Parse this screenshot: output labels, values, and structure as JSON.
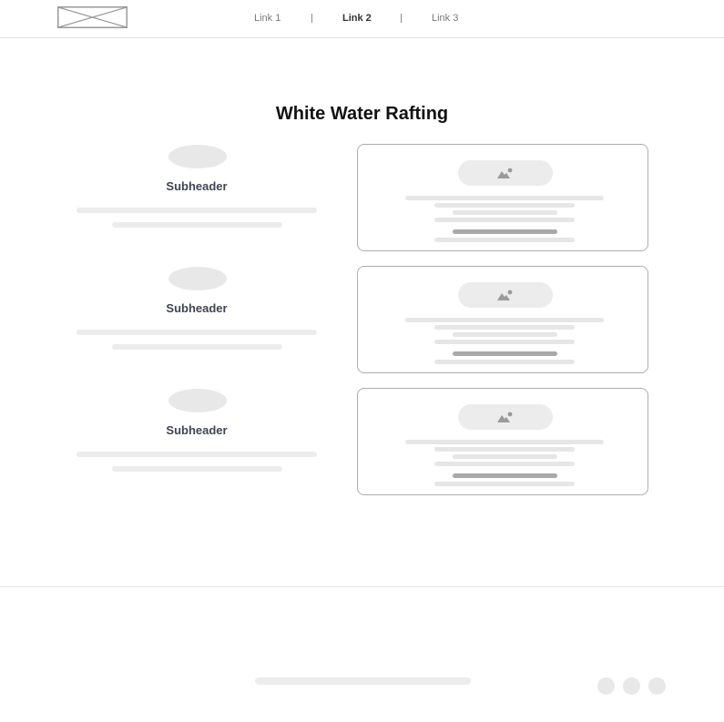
{
  "header": {
    "nav": [
      {
        "label": "Link 1",
        "active": false
      },
      {
        "label": "Link 2",
        "active": true
      },
      {
        "label": "Link 3",
        "active": false
      }
    ]
  },
  "main": {
    "title": "White Water Rafting",
    "features": [
      {
        "subheader": "Subheader"
      },
      {
        "subheader": "Subheader"
      },
      {
        "subheader": "Subheader"
      }
    ],
    "cards": [
      {
        "image_icon": "image-placeholder-icon"
      },
      {
        "image_icon": "image-placeholder-icon"
      },
      {
        "image_icon": "image-placeholder-icon"
      }
    ]
  },
  "footer": {
    "social_icons": [
      "social-icon",
      "social-icon",
      "social-icon"
    ]
  },
  "colors": {
    "title": "#111111",
    "subheader": "#3e4553",
    "placeholder": "#ececec",
    "card_border": "#adadad",
    "dark_line": "#a9a9a9"
  }
}
